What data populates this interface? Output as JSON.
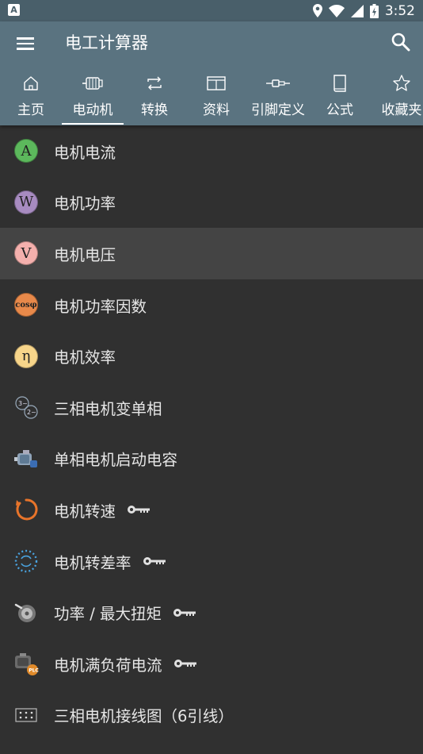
{
  "status_bar": {
    "time": "3:52",
    "notification_letter": "A"
  },
  "app_bar": {
    "title": "电工计算器"
  },
  "tabs": [
    {
      "label": "主页",
      "icon": "home-icon"
    },
    {
      "label": "电动机",
      "icon": "motor-icon",
      "active": true
    },
    {
      "label": "转换",
      "icon": "convert-icon"
    },
    {
      "label": "资料",
      "icon": "table-icon"
    },
    {
      "label": "引脚定义",
      "icon": "connector-icon"
    },
    {
      "label": "公式",
      "icon": "book-icon"
    },
    {
      "label": "收藏夹",
      "icon": "star-icon"
    }
  ],
  "items": [
    {
      "label": "电机电流",
      "badge": "A",
      "badge_color": "#5cb85c"
    },
    {
      "label": "电机功率",
      "badge": "W",
      "badge_color": "#a78bc0"
    },
    {
      "label": "电机电压",
      "badge": "V",
      "badge_color": "#f2a7a7",
      "selected": true
    },
    {
      "label": "电机功率因数",
      "badge": "cosφ",
      "badge_color": "#e8894a"
    },
    {
      "label": "电机效率",
      "badge": "η",
      "badge_color": "#f7d58a"
    },
    {
      "label": "三相电机变单相",
      "icon": "phase-convert-icon"
    },
    {
      "label": "单相电机启动电容",
      "icon": "motor-capacitor-icon"
    },
    {
      "label": "电机转速",
      "icon": "rotation-icon",
      "locked": true
    },
    {
      "label": "电机转差率",
      "icon": "slip-icon",
      "locked": true
    },
    {
      "label": "功率 / 最大扭矩",
      "icon": "torque-icon",
      "locked": true
    },
    {
      "label": "电机满负荷电流",
      "icon": "plc-motor-icon",
      "locked": true
    },
    {
      "label": "三相电机接线图（6引线）",
      "icon": "wiring-icon"
    }
  ]
}
